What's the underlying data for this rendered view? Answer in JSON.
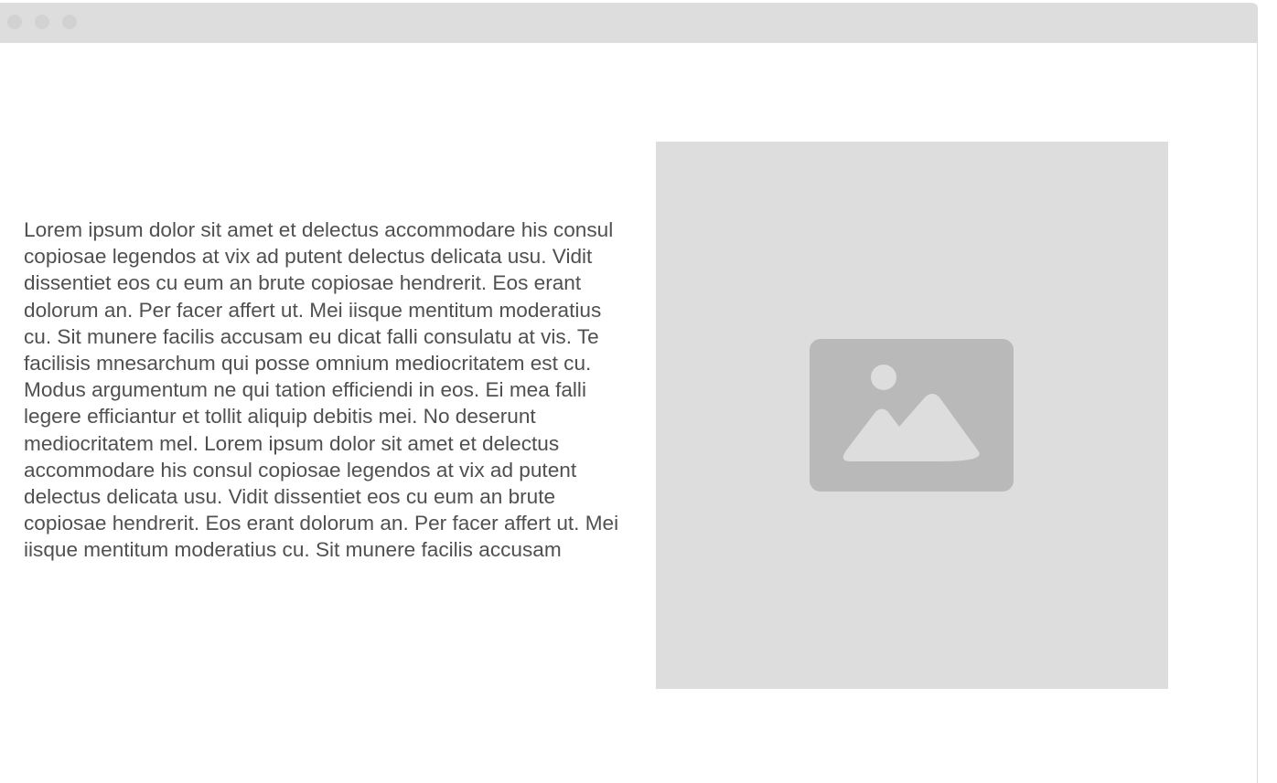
{
  "window": {
    "controls": [
      "close",
      "minimize",
      "maximize"
    ]
  },
  "content": {
    "paragraph": "Lorem ipsum dolor sit amet et delectus accommodare his consul copiosae legendos at vix ad putent delectus delicata usu. Vidit dissentiet eos cu eum an brute copiosae hendrerit. Eos erant dolorum an. Per facer affert ut. Mei iisque mentitum moderatius cu. Sit munere facilis accusam eu dicat falli consulatu at vis. Te facilisis mnesarchum qui posse omnium mediocritatem est cu. Modus argumentum ne qui tation efficiendi in eos. Ei mea falli legere efficiantur et tollit aliquip debitis mei. No deserunt mediocritatem mel. Lorem ipsum dolor sit amet et delectus accommodare his consul copiosae legendos at vix ad putent delectus delicata usu. Vidit dissentiet eos cu eum an brute copiosae hendrerit. Eos erant dolorum an. Per facer affert ut. Mei iisque mentitum moderatius cu. Sit munere facilis accusam",
    "image": {
      "icon": "image-icon"
    }
  },
  "colors": {
    "titlebar": "#dddddd",
    "window_dot": "#d2d2d2",
    "text": "#505050",
    "placeholder_bg": "#dddddd",
    "icon_bg": "#b9b9b9",
    "icon_fg": "#dddddd"
  }
}
